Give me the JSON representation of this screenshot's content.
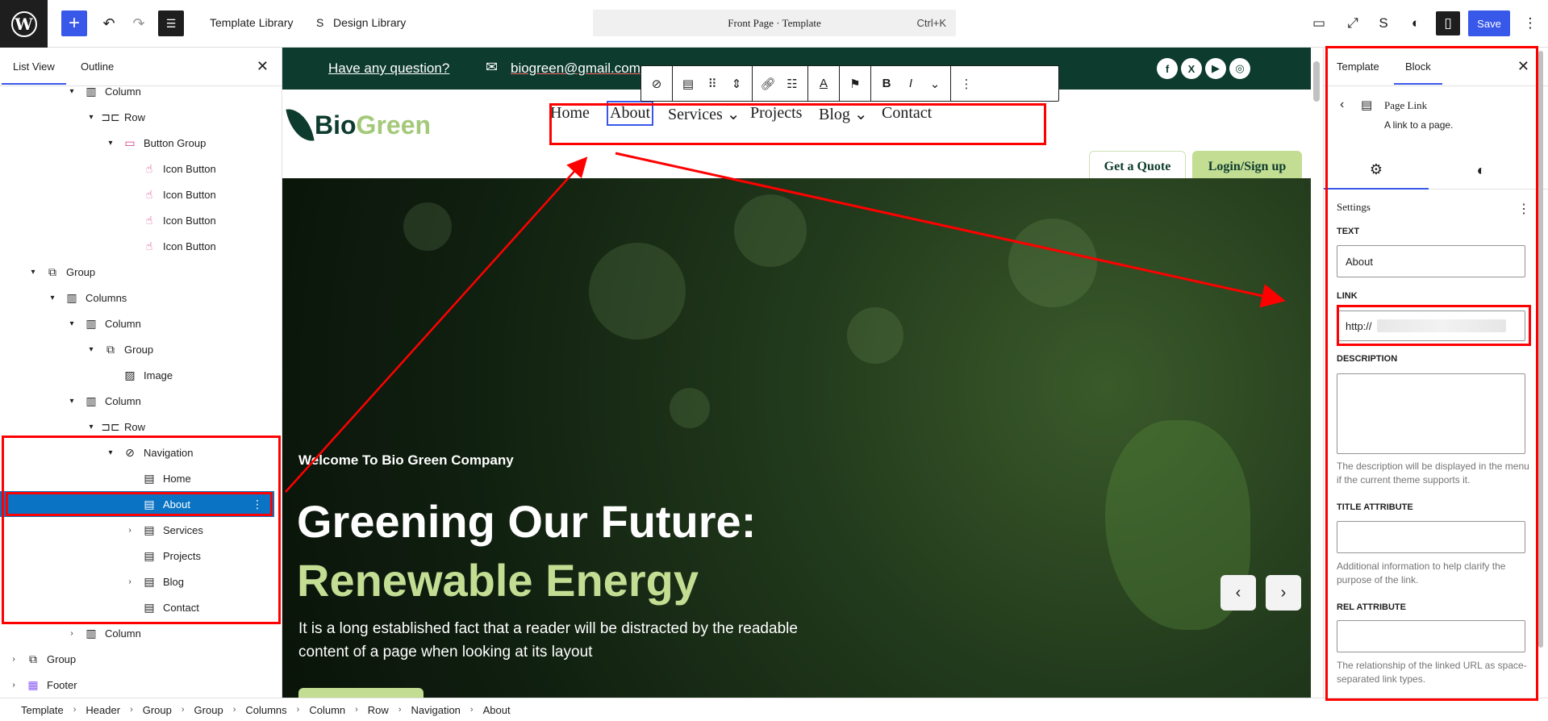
{
  "topbar": {
    "template_library": "Template Library",
    "design_library": "Design Library",
    "command": "Front Page · Template",
    "shortcut": "Ctrl+K",
    "save": "Save"
  },
  "list_view": {
    "tab_list": "List View",
    "tab_outline": "Outline",
    "rows": [
      {
        "label": "Column",
        "depth": 4,
        "chev": "▾",
        "icon": "▥"
      },
      {
        "label": "Row",
        "depth": 5,
        "chev": "▾",
        "icon": "⊐⊏"
      },
      {
        "label": "Button Group",
        "depth": 6,
        "chev": "▾",
        "icon": "▭"
      },
      {
        "label": "Icon Button",
        "depth": 7,
        "chev": "",
        "icon": "☝"
      },
      {
        "label": "Icon Button",
        "depth": 7,
        "chev": "",
        "icon": "☝"
      },
      {
        "label": "Icon Button",
        "depth": 7,
        "chev": "",
        "icon": "☝"
      },
      {
        "label": "Icon Button",
        "depth": 7,
        "chev": "",
        "icon": "☝"
      },
      {
        "label": "Group",
        "depth": 2,
        "chev": "▾",
        "icon": "⧉"
      },
      {
        "label": "Columns",
        "depth": 3,
        "chev": "▾",
        "icon": "▥"
      },
      {
        "label": "Column",
        "depth": 4,
        "chev": "▾",
        "icon": "▥"
      },
      {
        "label": "Group",
        "depth": 5,
        "chev": "▾",
        "icon": "⧉"
      },
      {
        "label": "Image",
        "depth": 6,
        "chev": "",
        "icon": "▨"
      },
      {
        "label": "Column",
        "depth": 4,
        "chev": "▾",
        "icon": "▥"
      },
      {
        "label": "Row",
        "depth": 5,
        "chev": "▾",
        "icon": "⊐⊏"
      },
      {
        "label": "Navigation",
        "depth": 6,
        "chev": "▾",
        "icon": "⊘"
      },
      {
        "label": "Home",
        "depth": 7,
        "chev": "",
        "icon": "▤"
      },
      {
        "label": "About",
        "depth": 7,
        "chev": "",
        "icon": "▤"
      },
      {
        "label": "Services",
        "depth": 7,
        "chev": "›",
        "icon": "▤"
      },
      {
        "label": "Projects",
        "depth": 7,
        "chev": "",
        "icon": "▤"
      },
      {
        "label": "Blog",
        "depth": 7,
        "chev": "›",
        "icon": "▤"
      },
      {
        "label": "Contact",
        "depth": 7,
        "chev": "",
        "icon": "▤"
      },
      {
        "label": "Column",
        "depth": 4,
        "chev": "›",
        "icon": "▥"
      },
      {
        "label": "Group",
        "depth": 1,
        "chev": "›",
        "icon": "⧉"
      },
      {
        "label": "Footer",
        "depth": 1,
        "chev": "›",
        "icon": "▦"
      }
    ]
  },
  "breadcrumb": [
    "Template",
    "Header",
    "Group",
    "Group",
    "Columns",
    "Column",
    "Row",
    "Navigation",
    "About"
  ],
  "site": {
    "question": "Have any question?",
    "email": "biogreen@gmail.com",
    "logo_bio": "Bio",
    "logo_green": "Green",
    "nav": [
      "Home",
      "About",
      "Services ⌄",
      "Projects",
      "Blog ⌄",
      "Contact"
    ],
    "quote": "Get a Quote",
    "login": "Login/Sign up",
    "welcome": "Welcome To Bio Green Company",
    "headline_1": "Greening Our Future:",
    "headline_2": "Renewable Energy",
    "paragraph": "It is a long established fact that a reader will be distracted by the readable content of a page when looking at its layout",
    "prev": "‹",
    "next": "›"
  },
  "inspector": {
    "tab_template": "Template",
    "tab_block": "Block",
    "block_title": "Page Link",
    "block_desc": "A link to a page.",
    "settings": "Settings",
    "text_label": "TEXT",
    "text_value": "About",
    "link_label": "LINK",
    "link_value": "http://",
    "desc_label": "DESCRIPTION",
    "desc_help": "The description will be displayed in the menu if the current theme supports it.",
    "title_label": "TITLE ATTRIBUTE",
    "title_help": "Additional information to help clarify the purpose of the link.",
    "rel_label": "REL ATTRIBUTE",
    "rel_help": "The relationship of the linked URL as space-separated link types."
  },
  "colors": {
    "accent": "#3858e9",
    "annotation": "#ff0000",
    "site_dark": "#0d3b2e",
    "site_green": "#c3dd93",
    "selected_row": "#0a73c4"
  }
}
